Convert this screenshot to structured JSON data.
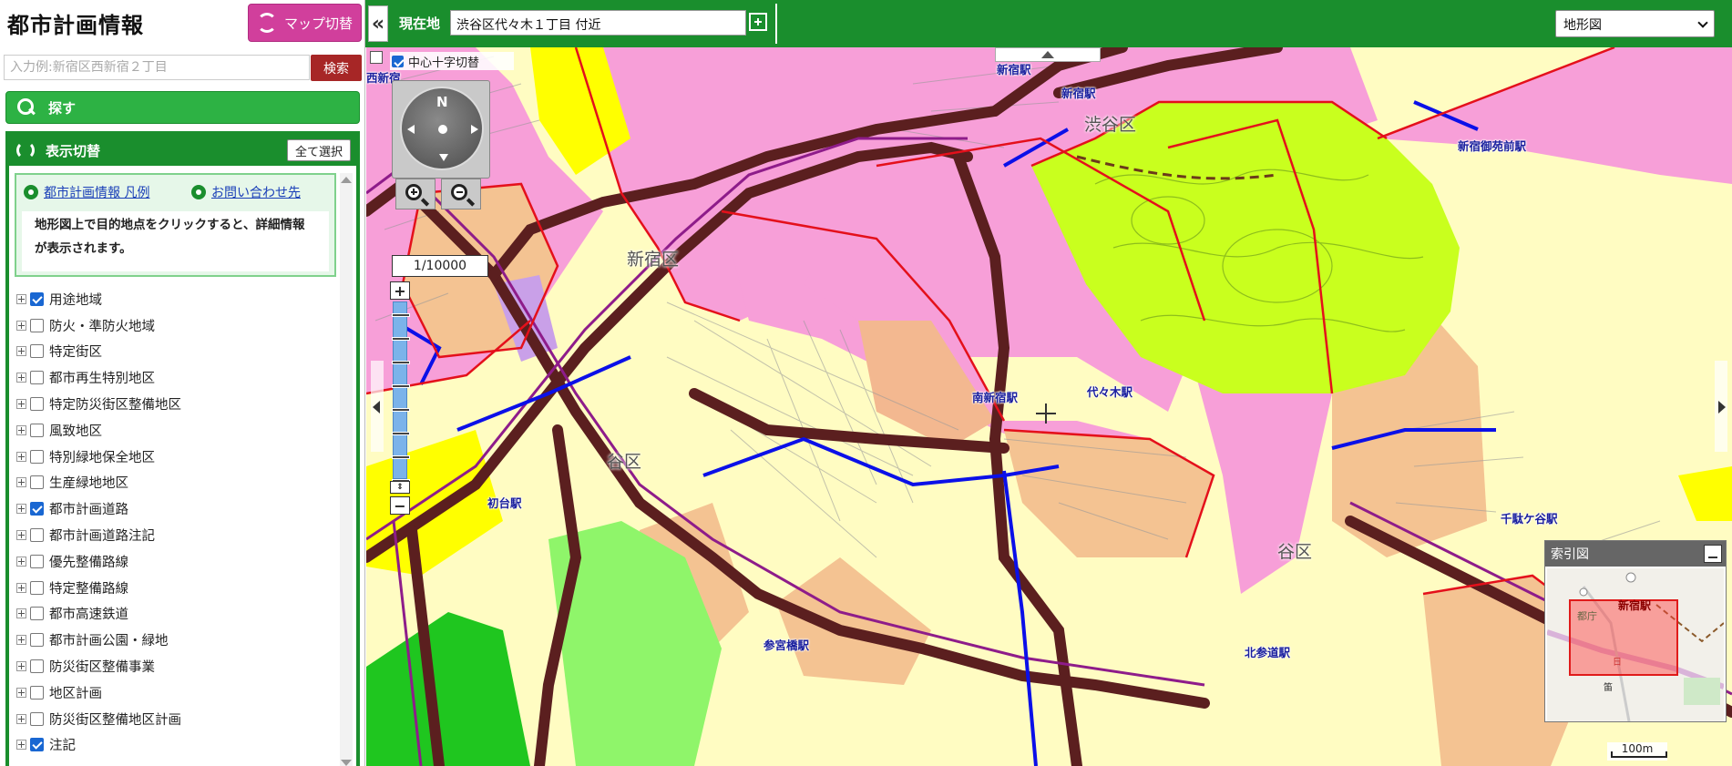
{
  "app": {
    "title": "都市計画情報",
    "map_switch_label": "マップ切替"
  },
  "search": {
    "placeholder": "入力例:新宿区西新宿２丁目",
    "button_label": "検索"
  },
  "find_bar": {
    "label": "探す"
  },
  "display_panel": {
    "header": "表示切替",
    "select_all": "全て選択",
    "legend_link": "都市計画情報 凡例",
    "contact_link": "お問い合わせ先",
    "note": "地形図上で目的地点をクリックすると、詳細情報が表示されます。"
  },
  "layers": [
    {
      "label": "用途地域",
      "checked": true
    },
    {
      "label": "防火・準防火地域",
      "checked": false
    },
    {
      "label": "特定街区",
      "checked": false
    },
    {
      "label": "都市再生特別地区",
      "checked": false
    },
    {
      "label": "特定防災街区整備地区",
      "checked": false
    },
    {
      "label": "風致地区",
      "checked": false
    },
    {
      "label": "特別緑地保全地区",
      "checked": false
    },
    {
      "label": "生産緑地地区",
      "checked": false
    },
    {
      "label": "都市計画道路",
      "checked": true
    },
    {
      "label": "都市計画道路注記",
      "checked": false
    },
    {
      "label": "優先整備路線",
      "checked": false
    },
    {
      "label": "特定整備路線",
      "checked": false
    },
    {
      "label": "都市高速鉄道",
      "checked": false
    },
    {
      "label": "都市計画公園・緑地",
      "checked": false
    },
    {
      "label": "防災街区整備事業",
      "checked": false
    },
    {
      "label": "地区計画",
      "checked": false
    },
    {
      "label": "防災街区整備地区計画",
      "checked": false
    },
    {
      "label": "注記",
      "checked": true
    }
  ],
  "topbar": {
    "collapse_glyph": "«",
    "location_label": "現在地",
    "location_value": "渋谷区代々木１丁目 付近",
    "basemap_selected": "地形図"
  },
  "map": {
    "crosshair_toggle_label": "中心十字切替",
    "crosshair_checked": true,
    "compass_north": "N",
    "scale": "1/10000",
    "scalebar_label": "100m",
    "zoom_slider_level": 0.7,
    "labels": [
      {
        "text": "新宿駅",
        "cls": "stn"
      },
      {
        "text": "新宿駅",
        "cls": "stn"
      },
      {
        "text": "渋谷区",
        "cls": "ward"
      },
      {
        "text": "新宿御苑前駅",
        "cls": "stn"
      },
      {
        "text": "新宿区",
        "cls": "ward"
      },
      {
        "text": "南新宿駅",
        "cls": "stn"
      },
      {
        "text": "代々木駅",
        "cls": "stn"
      },
      {
        "text": "谷区",
        "cls": "ward"
      },
      {
        "text": "初台駅",
        "cls": "stn"
      },
      {
        "text": "千駄ケ谷駅",
        "cls": "stn"
      },
      {
        "text": "谷区",
        "cls": "ward"
      },
      {
        "text": "参宮橋駅",
        "cls": "stn"
      },
      {
        "text": "北参道駅",
        "cls": "stn"
      },
      {
        "text": "西新宿",
        "cls": "stn"
      }
    ],
    "zone_colors": {
      "commercial": "#f79fd8",
      "neighborhood_commercial": "#f6b8e6",
      "residential_1": "#fffcc2",
      "residential_2": "#f4c392",
      "quasi_residential": "#f3b890",
      "low_rise_1": "#1fc61f",
      "low_rise_2": "#8ff56a",
      "park": "#c9ff1e",
      "industrial": "#ffff00",
      "boundary": "#e4101b",
      "road": "#5b1f1f",
      "rail": "#0b10e8",
      "cityplan_road": "#8e1c8a"
    }
  },
  "overview": {
    "title": "索引図",
    "station": "新宿駅",
    "ward": "都庁",
    "mark": "日",
    "park_mark": "笛"
  }
}
